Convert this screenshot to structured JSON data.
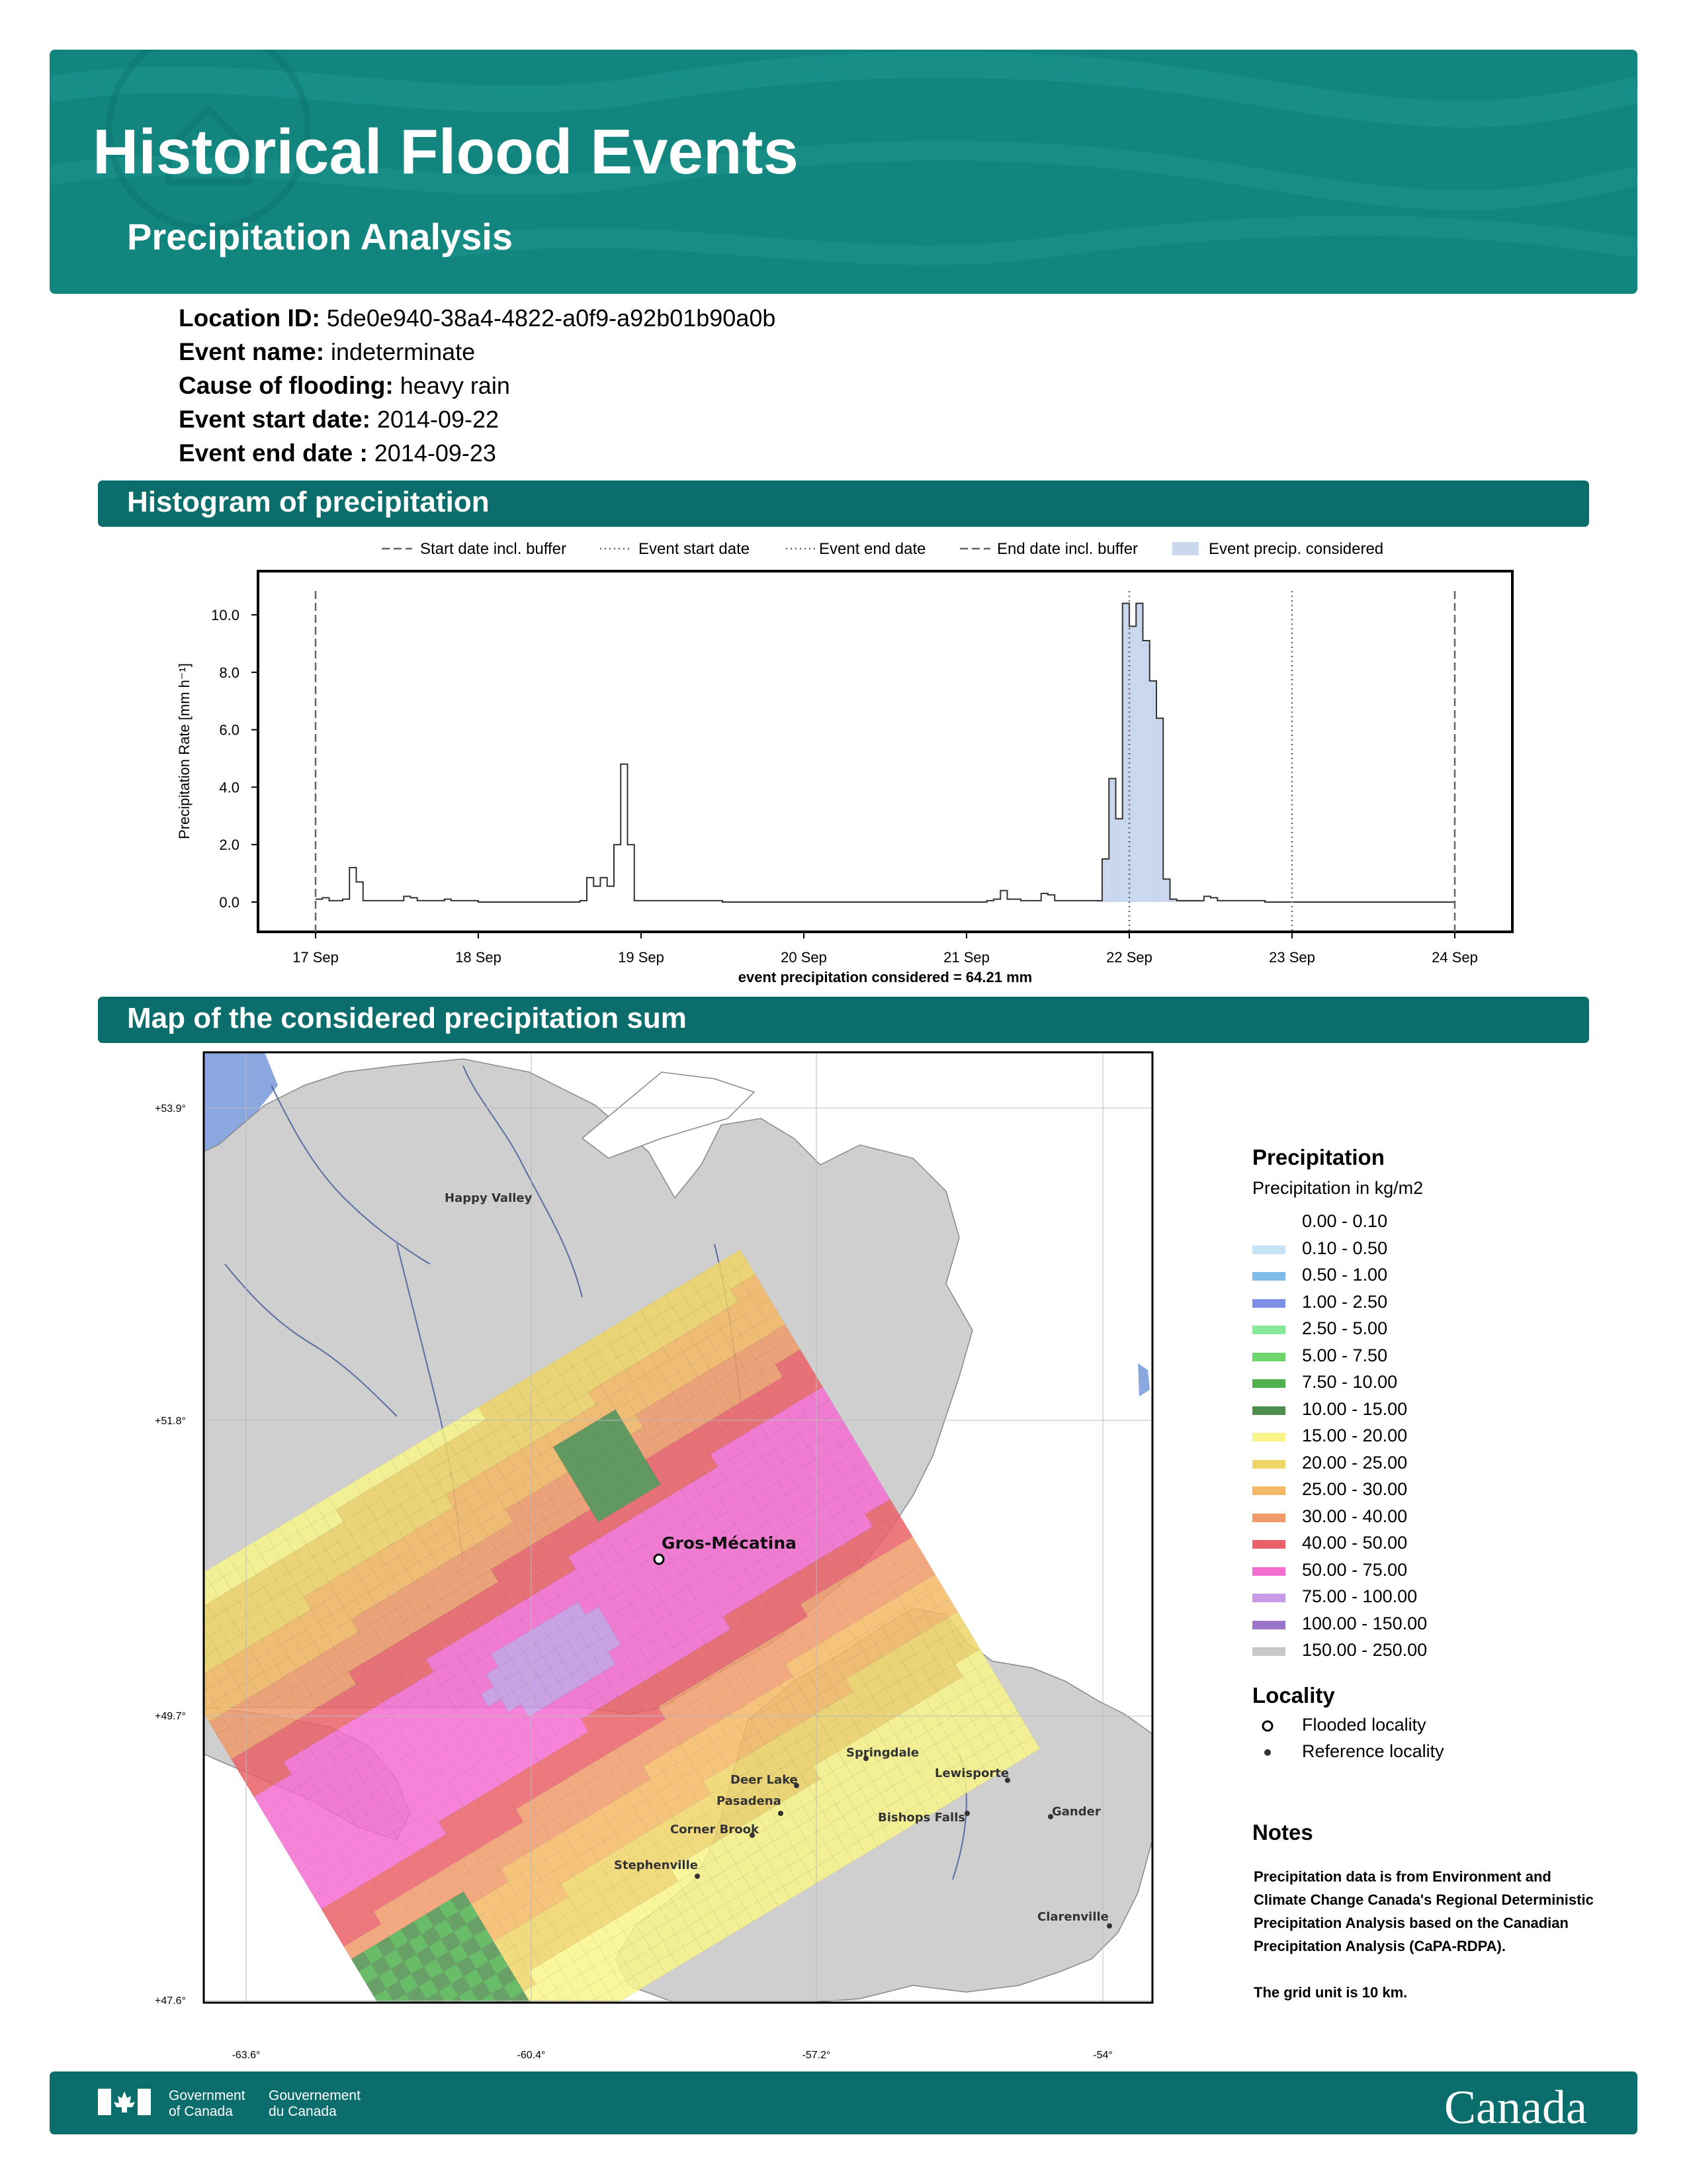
{
  "header": {
    "title": "Historical Flood Events",
    "subtitle": "Precipitation Analysis",
    "background_color": "#12857f"
  },
  "event": {
    "location_id_label": "Location ID:",
    "location_id": "5de0e940-38a4-4822-a0f9-a92b01b90a0b",
    "event_name_label": "Event name:",
    "event_name": "indeterminate",
    "cause_label": "Cause of flooding:",
    "cause": "heavy rain",
    "start_label": "Event start date:",
    "start_date": "2014-09-22",
    "end_label": "Event end date :",
    "end_date": "2014-09-23"
  },
  "sections": {
    "histogram": "Histogram of precipitation",
    "map": "Map of the considered precipitation sum"
  },
  "chart_data": {
    "type": "line",
    "xlabel": "",
    "ylabel": "Precipitation Rate [mm h⁻¹]",
    "ylim": [
      -0.5,
      11.5
    ],
    "yticks": [
      "0.0",
      "2.0",
      "4.0",
      "6.0",
      "8.0",
      "10.0"
    ],
    "x_ticks": [
      "17 Sep",
      "18 Sep",
      "19 Sep",
      "20 Sep",
      "21 Sep",
      "22 Sep",
      "23 Sep",
      "24 Sep"
    ],
    "annotation": "event precipitation considered = 64.21 mm",
    "legend": [
      "Start date incl. buffer",
      "Event start date",
      "Event end date",
      "End date incl. buffer",
      "Event precip. considered"
    ],
    "legend_position": "top",
    "vertical_lines": [
      {
        "name": "Start date incl. buffer",
        "x": "2014-09-17 00:00",
        "style": "dashed"
      },
      {
        "name": "Event start date",
        "x": "2014-09-22 00:00",
        "style": "dotted"
      },
      {
        "name": "Event end date",
        "x": "2014-09-23 00:00",
        "style": "dotted"
      },
      {
        "name": "End date incl. buffer",
        "x": "2014-09-24 00:00",
        "style": "dashed"
      }
    ],
    "series": [
      {
        "name": "",
        "x_unit": "hours after 2014-09-17 00:00",
        "points": [
          [
            0,
            0.1
          ],
          [
            1,
            0.15
          ],
          [
            2,
            0.05
          ],
          [
            3,
            0.05
          ],
          [
            4,
            0.1
          ],
          [
            5,
            1.2
          ],
          [
            6,
            0.7
          ],
          [
            7,
            0.05
          ],
          [
            10,
            0.05
          ],
          [
            12,
            0.05
          ],
          [
            13,
            0.2
          ],
          [
            14,
            0.15
          ],
          [
            15,
            0.05
          ],
          [
            18,
            0.05
          ],
          [
            19,
            0.1
          ],
          [
            20,
            0.05
          ],
          [
            24,
            0.0
          ],
          [
            38,
            0.0
          ],
          [
            39,
            0.05
          ],
          [
            40,
            0.85
          ],
          [
            41,
            0.55
          ],
          [
            42,
            0.85
          ],
          [
            43,
            0.55
          ],
          [
            44,
            2.0
          ],
          [
            45,
            4.8
          ],
          [
            46,
            2.0
          ],
          [
            47,
            0.05
          ],
          [
            48,
            0.05
          ],
          [
            60,
            0.0
          ],
          [
            84,
            0.0
          ],
          [
            99,
            0.05
          ],
          [
            100,
            0.1
          ],
          [
            101,
            0.4
          ],
          [
            102,
            0.1
          ],
          [
            104,
            0.05
          ],
          [
            106,
            0.05
          ],
          [
            107,
            0.3
          ],
          [
            108,
            0.25
          ],
          [
            109,
            0.05
          ],
          [
            110,
            0.05
          ],
          [
            111,
            0.05
          ],
          [
            112,
            0.05
          ],
          [
            113,
            0.05
          ],
          [
            114,
            0.05
          ],
          [
            115,
            0.05
          ],
          [
            116,
            1.5
          ],
          [
            117,
            4.3
          ],
          [
            118,
            2.9
          ],
          [
            119,
            10.4
          ],
          [
            120,
            9.6
          ],
          [
            121,
            10.4
          ],
          [
            122,
            9.1
          ],
          [
            123,
            7.7
          ],
          [
            124,
            6.4
          ],
          [
            125,
            0.8
          ],
          [
            126,
            0.1
          ],
          [
            127,
            0.05
          ],
          [
            130,
            0.05
          ],
          [
            131,
            0.2
          ],
          [
            132,
            0.15
          ],
          [
            133,
            0.05
          ],
          [
            136,
            0.05
          ],
          [
            139,
            0.05
          ],
          [
            140,
            0.0
          ],
          [
            168,
            0.0
          ]
        ]
      }
    ],
    "considered_range_hours": [
      115,
      131
    ],
    "considered_color": "#c9d8ee"
  },
  "map": {
    "lat_ticks": [
      "+53.9°",
      "+51.8°",
      "+49.7°",
      "+47.6°"
    ],
    "lon_ticks": [
      "-63.6°",
      "-60.4°",
      "-57.2°",
      "-54°"
    ],
    "flooded_locality": "Gros-Mécatina",
    "reference_localities": [
      "Happy Valley",
      "Springdale",
      "Lewisporte",
      "Deer Lake",
      "Pasadena",
      "Bishops Falls",
      "Gander",
      "Corner Brook",
      "Stephenville",
      "Clarenville"
    ],
    "water_color": "#8aa8df",
    "land_color": "#cfcfcf"
  },
  "legend": {
    "title": "Precipitation",
    "subtitle": "Precipitation in kg/m2",
    "classes": [
      {
        "label": "0.00 - 0.10",
        "color": "#ffffff"
      },
      {
        "label": "0.10 - 0.50",
        "color": "#c6e3f6"
      },
      {
        "label": "0.50 - 1.00",
        "color": "#7fbde8"
      },
      {
        "label": "1.00 - 2.50",
        "color": "#7d8fe6"
      },
      {
        "label": "2.50 - 5.00",
        "color": "#85e89a"
      },
      {
        "label": "5.00 - 7.50",
        "color": "#6fd66e"
      },
      {
        "label": "7.50 - 10.00",
        "color": "#4fb04e"
      },
      {
        "label": "10.00 - 15.00",
        "color": "#4e8f4e"
      },
      {
        "label": "15.00 - 20.00",
        "color": "#f8f48a"
      },
      {
        "label": "20.00 - 25.00",
        "color": "#f0d567"
      },
      {
        "label": "25.00 - 30.00",
        "color": "#f3b965"
      },
      {
        "label": "30.00 - 40.00",
        "color": "#f09a6a"
      },
      {
        "label": "40.00 - 50.00",
        "color": "#ea6168"
      },
      {
        "label": "50.00 - 75.00",
        "color": "#f46dd1"
      },
      {
        "label": "75.00 - 100.00",
        "color": "#c79ae7"
      },
      {
        "label": "100.00 - 150.00",
        "color": "#9a74c9"
      },
      {
        "label": "150.00 - 250.00",
        "color": "#c8c8c8"
      }
    ],
    "locality_title": "Locality",
    "flooded_label": "Flooded locality",
    "reference_label": "Reference locality"
  },
  "notes": {
    "title": "Notes",
    "text1": "Precipitation data is from Environment and Climate Change Canada's Regional Deterministic Precipitation Analysis based on the Canadian Precipitation Analysis (CaPA-RDPA).",
    "text2": "The grid unit is 10 km."
  },
  "footer": {
    "gov_en_1": "Government",
    "gov_en_2": "of Canada",
    "gov_fr_1": "Gouvernement",
    "gov_fr_2": "du Canada",
    "wordmark": "Canada"
  }
}
